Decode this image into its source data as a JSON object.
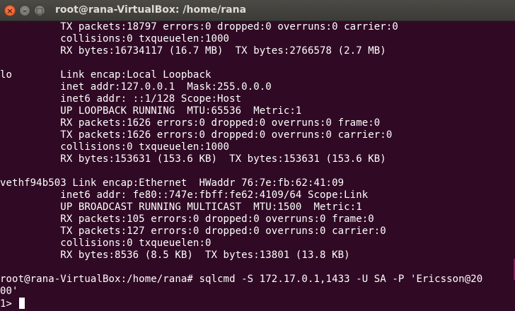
{
  "window": {
    "title": "root@rana-VirtualBox: /home/rana",
    "close_glyph": "×",
    "minimize_glyph": "–",
    "maximize_glyph": "□"
  },
  "terminal": {
    "background": "#300a24",
    "foreground": "#ffffff",
    "lines": [
      "          TX packets:18797 errors:0 dropped:0 overruns:0 carrier:0",
      "          collisions:0 txqueuelen:1000",
      "          RX bytes:16734117 (16.7 MB)  TX bytes:2766578 (2.7 MB)",
      "",
      "lo        Link encap:Local Loopback",
      "          inet addr:127.0.0.1  Mask:255.0.0.0",
      "          inet6 addr: ::1/128 Scope:Host",
      "          UP LOOPBACK RUNNING  MTU:65536  Metric:1",
      "          RX packets:1626 errors:0 dropped:0 overruns:0 frame:0",
      "          TX packets:1626 errors:0 dropped:0 overruns:0 carrier:0",
      "          collisions:0 txqueuelen:1000",
      "          RX bytes:153631 (153.6 KB)  TX bytes:153631 (153.6 KB)",
      "",
      "vethf94b503 Link encap:Ethernet  HWaddr 76:7e:fb:62:41:09",
      "          inet6 addr: fe80::747e:fbff:fe62:4109/64 Scope:Link",
      "          UP BROADCAST RUNNING MULTICAST  MTU:1500  Metric:1",
      "          RX packets:105 errors:0 dropped:0 overruns:0 frame:0",
      "          TX packets:127 errors:0 dropped:0 overruns:0 carrier:0",
      "          collisions:0 txqueuelen:0",
      "          RX bytes:8536 (8.5 KB)  TX bytes:13801 (13.8 KB)",
      "",
      "root@rana-VirtualBox:/home/rana# sqlcmd -S 172.17.0.1,1433 -U SA -P 'Ericsson@20",
      "00'",
      "1> "
    ]
  }
}
